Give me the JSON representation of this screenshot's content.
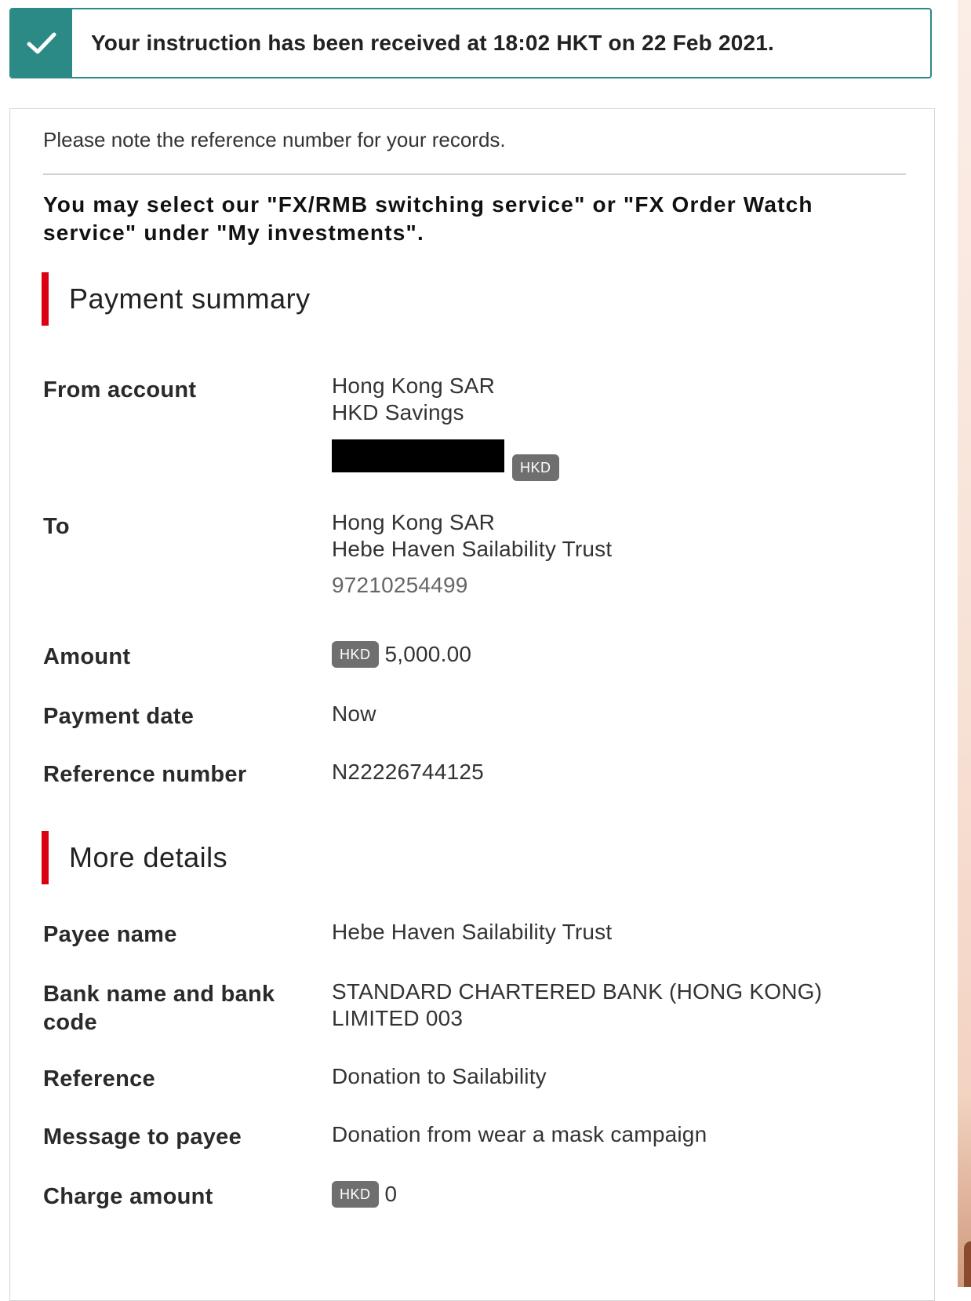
{
  "banner": {
    "message": "Your instruction has been received at 18:02 HKT on 22 Feb 2021.",
    "status_icon": "check-icon",
    "color": "#2b8a85"
  },
  "note": "Please note the reference number for your records.",
  "fx_notice": "You may select our \"FX/RMB switching service\" or \"FX Order Watch service\" under \"My investments\".",
  "payment_summary": {
    "heading": "Payment summary",
    "accent_color": "#db0011",
    "from_account": {
      "label": "From account",
      "region": "Hong Kong SAR",
      "account_type": "HKD Savings",
      "currency_badge": "HKD"
    },
    "to": {
      "label": "To",
      "region": "Hong Kong SAR",
      "payee": "Hebe Haven Sailability Trust",
      "account_number": "97210254499"
    },
    "amount": {
      "label": "Amount",
      "currency": "HKD",
      "value": "5,000.00"
    },
    "payment_date": {
      "label": "Payment date",
      "value": "Now"
    },
    "reference_number": {
      "label": "Reference number",
      "value": "N22226744125"
    }
  },
  "more_details": {
    "heading": "More details",
    "payee_name": {
      "label": "Payee name",
      "value": "Hebe Haven Sailability Trust"
    },
    "bank": {
      "label": "Bank name and bank code",
      "value": "STANDARD CHARTERED BANK (HONG KONG) LIMITED 003"
    },
    "reference": {
      "label": "Reference",
      "value": "Donation to Sailability"
    },
    "message": {
      "label": "Message to payee",
      "value": "Donation from wear a mask campaign"
    },
    "charge": {
      "label": "Charge amount",
      "currency": "HKD",
      "value": "0"
    }
  }
}
